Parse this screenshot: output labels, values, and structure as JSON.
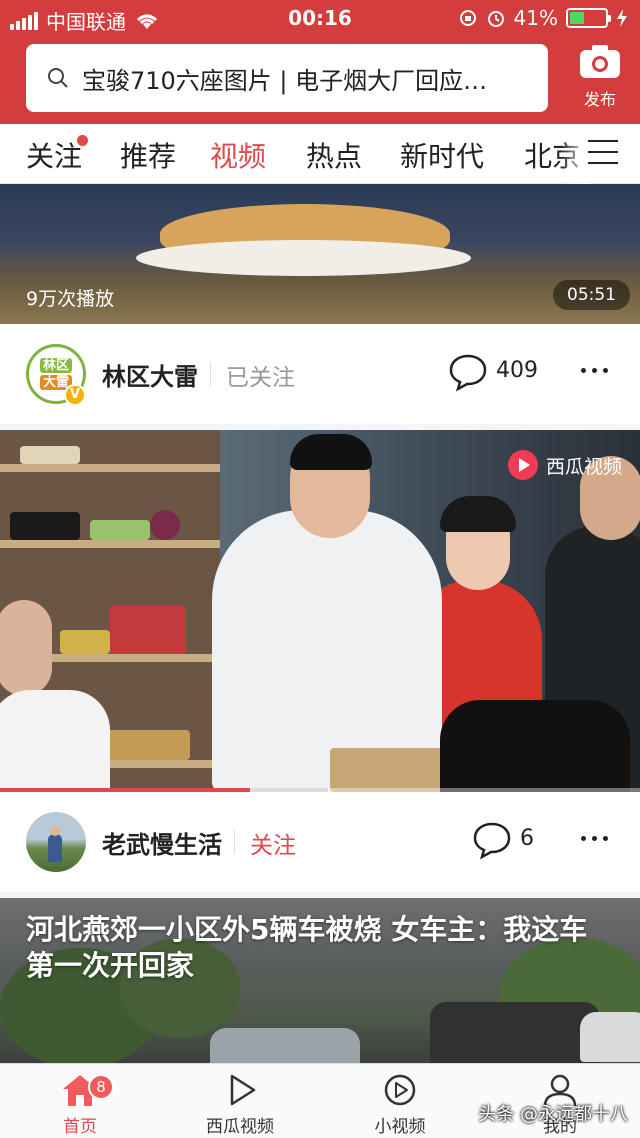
{
  "status": {
    "carrier": "中国联通",
    "time": "00:16",
    "battery": "41%",
    "battery_level": 0.41
  },
  "header": {
    "search_text": "宝骏710六座图片 | 电子烟大厂回应…",
    "publish_label": "发布"
  },
  "tabs": [
    {
      "label": "关注",
      "has_dot": true
    },
    {
      "label": "推荐"
    },
    {
      "label": "视频",
      "active": true
    },
    {
      "label": "热点"
    },
    {
      "label": "新时代"
    },
    {
      "label": "北京"
    }
  ],
  "feed": [
    {
      "views": "9万次播放",
      "duration": "05:51",
      "author": {
        "name": "林区大雷",
        "avatar_text": [
          "林区",
          "大雷"
        ],
        "verified_badge": "V",
        "follow_label": "已关注",
        "comments": "409"
      }
    },
    {
      "watermark": "西瓜视频",
      "progress": 0.39,
      "author": {
        "name": "老武慢生活",
        "follow_label": "关注",
        "comments": "6"
      }
    },
    {
      "title": "河北燕郊一小区外5辆车被烧 女车主：我这车第一次开回家"
    }
  ],
  "bottom_nav": [
    {
      "label": "首页",
      "icon": "home-icon",
      "badge": "8",
      "active": true
    },
    {
      "label": "西瓜视频",
      "icon": "play-icon"
    },
    {
      "label": "小视频",
      "icon": "small-video-icon"
    },
    {
      "label": "我的",
      "icon": "user-icon"
    }
  ],
  "source_watermark": "头条 @永远都十八",
  "colors": {
    "brand_red": "#d43d3d",
    "active_red": "#e0484a",
    "badge_red": "#f05b5b"
  }
}
